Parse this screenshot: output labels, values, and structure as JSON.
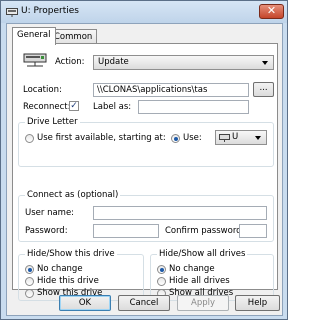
{
  "window": {
    "title": "U: Properties",
    "close_glyph": "✕"
  },
  "tabs": [
    {
      "label": "General",
      "active": true
    },
    {
      "label": "Common",
      "active": false
    }
  ],
  "general": {
    "action_label": "Action:",
    "action_value": "Update",
    "location_label": "Location:",
    "location_value": "\\\\CLONAS\\applications\\tas",
    "browse_label": "...",
    "reconnect_label": "Reconnect:",
    "reconnect_checked": "✓",
    "label_as_label": "Label as:",
    "label_as_value": ""
  },
  "drive_letter": {
    "title": "Drive Letter",
    "use_first_label": "Use first available, starting at:",
    "use_label": "Use:",
    "use_value": "U"
  },
  "connect_as": {
    "title": "Connect as (optional)",
    "username_label": "User name:",
    "password_label": "Password:",
    "confirm_label": "Confirm password:"
  },
  "hide_this": {
    "title": "Hide/Show this drive",
    "options": [
      "No change",
      "Hide this drive",
      "Show this drive"
    ]
  },
  "hide_all": {
    "title": "Hide/Show all drives",
    "options": [
      "No change",
      "Hide all drives",
      "Show all drives"
    ]
  },
  "buttons": {
    "ok": "OK",
    "cancel": "Cancel",
    "apply": "Apply",
    "help": "Help"
  }
}
